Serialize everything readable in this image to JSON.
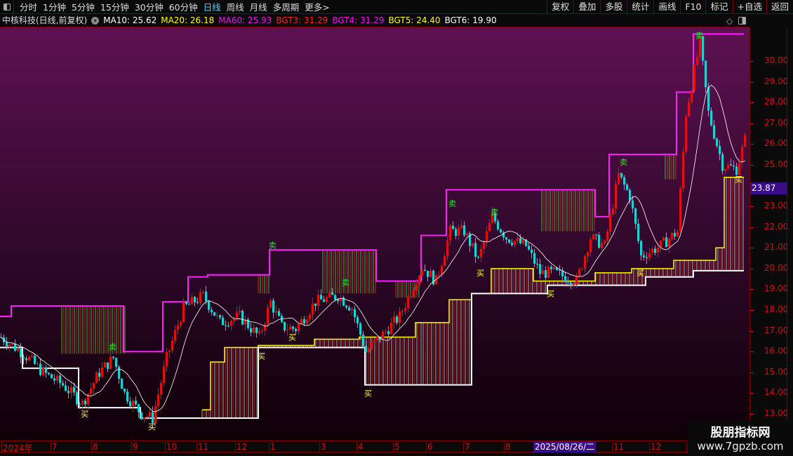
{
  "toolbar": {
    "periods": [
      "分时",
      "1分钟",
      "5分钟",
      "15分钟",
      "30分钟",
      "60分钟",
      "日线",
      "周线",
      "月线",
      "多周期",
      "更多>"
    ],
    "active_period": "日线",
    "buttons": [
      "复权",
      "叠加",
      "多股",
      "统计",
      "画线",
      "F10",
      "标记",
      "+自选",
      "返回"
    ]
  },
  "info": {
    "title": "中核科技(日线,前复权)",
    "ma10": "MA10: 25.62",
    "ma20": "MA20: 26.18",
    "ma60": "MA60: 25.93",
    "bgt3": "BGT3: 31.29",
    "bgt4": "BGT4: 31.29",
    "bgt5": "BGT5: 24.40",
    "bgt6": "BGT6: 19.90"
  },
  "colors": {
    "ma10": "#ffffff",
    "ma20": "#ffff00",
    "ma60": "#ff00ff",
    "bgt3": "#ff2020",
    "bgt4": "#ff00ff",
    "bgt5": "#ffff00",
    "bgt6": "#ffffff",
    "up": "#e01010",
    "down": "#20d0d0"
  },
  "axis": {
    "current_price": "23.87",
    "ticks": [
      "30.00",
      "29.00",
      "28.00",
      "27.00",
      "26.00",
      "25.00",
      "23.00",
      "22.00",
      "21.00",
      "20.00",
      "19.00",
      "18.00",
      "17.00",
      "16.00",
      "15.00",
      "14.00",
      "13.00"
    ]
  },
  "xaxis": {
    "labels": [
      "2024年",
      "7",
      "8",
      "9",
      "10",
      "11",
      "12",
      "1",
      "3",
      "4",
      "5",
      "6",
      "7",
      "8",
      "11",
      "12",
      "1"
    ],
    "cursor_date": "2025/08/26/二"
  },
  "watermark": {
    "name": "股朋指标网",
    "url": "www.7gpzb.com"
  },
  "chart_data": {
    "type": "candlestick",
    "ylim": [
      12.5,
      31.5
    ],
    "x_unit": "trading-day index",
    "price_path": [
      [
        0,
        16.7
      ],
      [
        8,
        15.9
      ],
      [
        15,
        15.0
      ],
      [
        22,
        14.4
      ],
      [
        29,
        13.5
      ],
      [
        35,
        15.0
      ],
      [
        40,
        15.7
      ],
      [
        44,
        14.0
      ],
      [
        50,
        13.0
      ],
      [
        54,
        12.8
      ],
      [
        59,
        15.7
      ],
      [
        65,
        18.1
      ],
      [
        72,
        18.7
      ],
      [
        78,
        17.4
      ],
      [
        85,
        17.7
      ],
      [
        92,
        16.7
      ],
      [
        96,
        18.4
      ],
      [
        100,
        17.2
      ],
      [
        105,
        17.1
      ],
      [
        112,
        18.4
      ],
      [
        120,
        18.7
      ],
      [
        125,
        18.1
      ],
      [
        130,
        16.0
      ],
      [
        135,
        16.7
      ],
      [
        142,
        17.7
      ],
      [
        150,
        20.1
      ],
      [
        155,
        19.4
      ],
      [
        160,
        21.8
      ],
      [
        165,
        21.8
      ],
      [
        170,
        20.4
      ],
      [
        175,
        22.5
      ],
      [
        180,
        21.5
      ],
      [
        187,
        21.1
      ],
      [
        192,
        19.8
      ],
      [
        197,
        19.8
      ],
      [
        205,
        19.4
      ],
      [
        210,
        21.5
      ],
      [
        215,
        21.1
      ],
      [
        220,
        24.5
      ],
      [
        224,
        23.5
      ],
      [
        228,
        20.6
      ],
      [
        235,
        21.1
      ],
      [
        241,
        21.8
      ],
      [
        244,
        27.5
      ],
      [
        249,
        30.9
      ],
      [
        252,
        27.5
      ],
      [
        257,
        25.0
      ],
      [
        262,
        24.8
      ],
      [
        265,
        26.2
      ]
    ],
    "bgt3_upper": [
      [
        0,
        4,
        17.7
      ],
      [
        4,
        44,
        18.2
      ],
      [
        44,
        58,
        16.0
      ],
      [
        58,
        67,
        18.4
      ],
      [
        67,
        74,
        19.6
      ],
      [
        74,
        96,
        19.7
      ],
      [
        96,
        134,
        20.9
      ],
      [
        134,
        150,
        19.4
      ],
      [
        150,
        159,
        21.6
      ],
      [
        159,
        212,
        23.8
      ],
      [
        212,
        217,
        22.5
      ],
      [
        217,
        241,
        25.5
      ],
      [
        241,
        247,
        28.5
      ],
      [
        247,
        265,
        31.3
      ]
    ],
    "bgt6_lower": [
      [
        0,
        8,
        16.2
      ],
      [
        8,
        28,
        15.2
      ],
      [
        28,
        50,
        13.3
      ],
      [
        50,
        92,
        12.8
      ],
      [
        92,
        130,
        16.2
      ],
      [
        130,
        168,
        14.4
      ],
      [
        168,
        195,
        18.8
      ],
      [
        195,
        230,
        19.2
      ],
      [
        230,
        247,
        19.6
      ],
      [
        247,
        265,
        19.9
      ]
    ],
    "bgt5": [
      [
        72,
        75,
        13.2
      ],
      [
        75,
        80,
        15.5
      ],
      [
        80,
        92,
        16.2
      ],
      [
        92,
        112,
        16.3
      ],
      [
        112,
        128,
        16.6
      ],
      [
        128,
        148,
        16.7
      ],
      [
        148,
        160,
        17.4
      ],
      [
        160,
        168,
        18.5
      ],
      [
        168,
        175,
        18.8
      ],
      [
        175,
        190,
        20.0
      ],
      [
        190,
        212,
        19.4
      ],
      [
        212,
        225,
        19.8
      ],
      [
        225,
        240,
        20.0
      ],
      [
        240,
        255,
        20.4
      ],
      [
        255,
        258,
        21.0
      ],
      [
        258,
        265,
        24.4
      ]
    ],
    "signals": [
      {
        "day": 30,
        "price": 13.2,
        "label": "买"
      },
      {
        "day": 54,
        "price": 12.6,
        "label": "买"
      },
      {
        "day": 93,
        "price": 16.0,
        "label": "买"
      },
      {
        "day": 104,
        "price": 16.9,
        "label": "买"
      },
      {
        "day": 131,
        "price": 14.2,
        "label": "买"
      },
      {
        "day": 171,
        "price": 20.0,
        "label": "买"
      },
      {
        "day": 196,
        "price": 19.0,
        "label": "买"
      },
      {
        "day": 228,
        "price": 20.0,
        "label": "买"
      },
      {
        "day": 263,
        "price": 24.5,
        "label": "买"
      },
      {
        "day": 40,
        "price": 16.1,
        "label": "卖"
      },
      {
        "day": 97,
        "price": 21.0,
        "label": "卖"
      },
      {
        "day": 123,
        "price": 19.2,
        "label": "卖"
      },
      {
        "day": 161,
        "price": 23.0,
        "label": "卖"
      },
      {
        "day": 176,
        "price": 22.6,
        "label": "卖"
      },
      {
        "day": 222,
        "price": 25.0,
        "label": "卖"
      },
      {
        "day": 249,
        "price": 31.1,
        "label": "卖"
      }
    ]
  }
}
